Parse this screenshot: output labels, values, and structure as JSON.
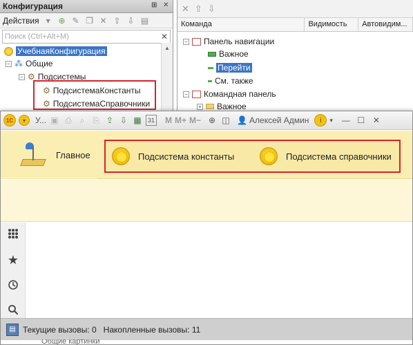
{
  "configurator": {
    "title": "Конфигурация",
    "actions_label": "Действия",
    "search_placeholder": "Поиск (Ctrl+Alt+M)",
    "tree": {
      "root": "УчебнаяКонфигурация",
      "common": "Общие",
      "subsystems": "Подсистемы",
      "children": [
        "ПодсистемаКонстанты",
        "ПодсистемаСправочники"
      ],
      "cut_off_text": "Общие картинки"
    }
  },
  "command_editor": {
    "columns": [
      "Команда",
      "Видимость",
      "Автовидим..."
    ],
    "rows": [
      {
        "label": "Панель навигации",
        "level": 0
      },
      {
        "label": "Важное",
        "level": 1
      },
      {
        "label": "Перейти",
        "level": 1,
        "selected": true
      },
      {
        "label": "См. также",
        "level": 1
      },
      {
        "label": "Командная панель",
        "level": 0
      },
      {
        "label": "Важное",
        "level": 1
      }
    ]
  },
  "client": {
    "title_short": "У...",
    "zoom_buttons": [
      "M",
      "M+",
      "M−"
    ],
    "user": "Алексей Админ",
    "calendar_day": "31",
    "home_label": "Главное",
    "sections": [
      "Подсистема константы",
      "Подсистема справочники"
    ],
    "status": "Текущие вызовы: 0   Накопленные вызовы: 11"
  },
  "colors": {
    "highlight_border": "#d9222a",
    "sections_bg": "#fbeeb2",
    "selection_blue": "#3b74c4"
  }
}
